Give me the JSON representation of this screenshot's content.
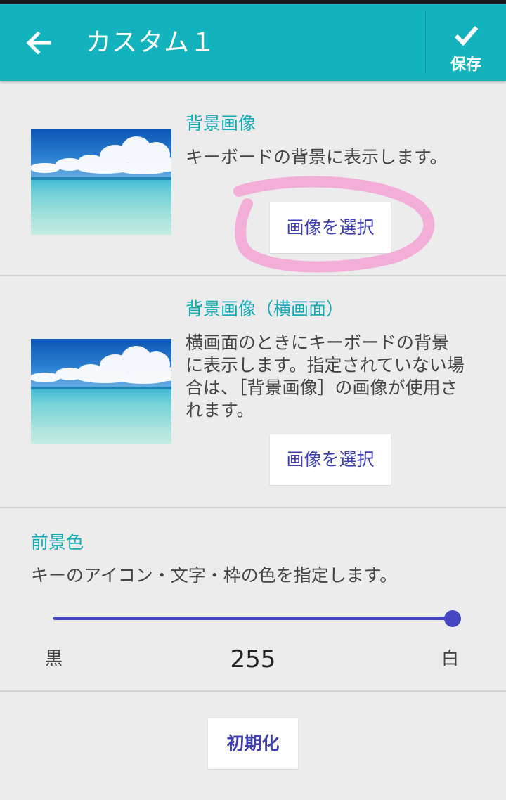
{
  "appbar": {
    "title": "カスタム１",
    "back_icon": "arrow-left-icon",
    "save_label": "保存",
    "save_icon": "check-icon",
    "color": "#12b3bd"
  },
  "background_image": {
    "title": "背景画像",
    "description": "キーボードの背景に表示します。",
    "button_label": "画像を選択"
  },
  "background_image_landscape": {
    "title": "背景画像（横画面）",
    "description": "横画面のときにキーボードの背景に表示します。指定されていない場合は、［背景画像］の画像が使用されます。",
    "button_label": "画像を選択"
  },
  "foreground_color": {
    "title": "前景色",
    "description": "キーのアイコン・文字・枠の色を指定します。",
    "slider_min_label": "黒",
    "slider_max_label": "白",
    "slider_value": "255",
    "slider_fraction": 1.0,
    "accent_color": "#4646c2"
  },
  "reset_button_label": "初期化"
}
